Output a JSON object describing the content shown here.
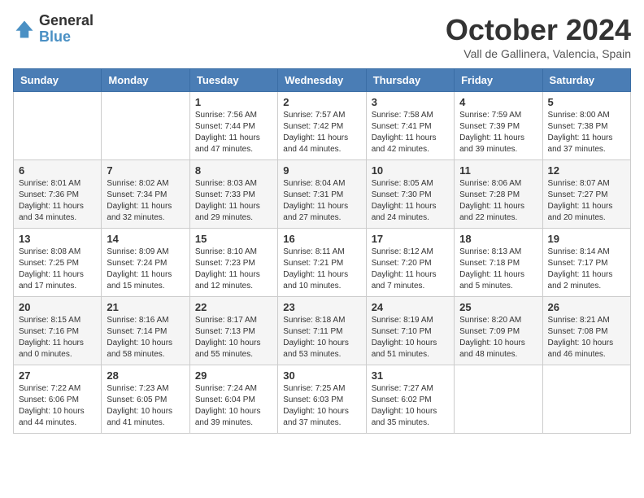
{
  "logo": {
    "general": "General",
    "blue": "Blue"
  },
  "header": {
    "month": "October 2024",
    "location": "Vall de Gallinera, Valencia, Spain"
  },
  "days_of_week": [
    "Sunday",
    "Monday",
    "Tuesday",
    "Wednesday",
    "Thursday",
    "Friday",
    "Saturday"
  ],
  "weeks": [
    [
      {
        "day": "",
        "info": ""
      },
      {
        "day": "",
        "info": ""
      },
      {
        "day": "1",
        "info": "Sunrise: 7:56 AM\nSunset: 7:44 PM\nDaylight: 11 hours and 47 minutes."
      },
      {
        "day": "2",
        "info": "Sunrise: 7:57 AM\nSunset: 7:42 PM\nDaylight: 11 hours and 44 minutes."
      },
      {
        "day": "3",
        "info": "Sunrise: 7:58 AM\nSunset: 7:41 PM\nDaylight: 11 hours and 42 minutes."
      },
      {
        "day": "4",
        "info": "Sunrise: 7:59 AM\nSunset: 7:39 PM\nDaylight: 11 hours and 39 minutes."
      },
      {
        "day": "5",
        "info": "Sunrise: 8:00 AM\nSunset: 7:38 PM\nDaylight: 11 hours and 37 minutes."
      }
    ],
    [
      {
        "day": "6",
        "info": "Sunrise: 8:01 AM\nSunset: 7:36 PM\nDaylight: 11 hours and 34 minutes."
      },
      {
        "day": "7",
        "info": "Sunrise: 8:02 AM\nSunset: 7:34 PM\nDaylight: 11 hours and 32 minutes."
      },
      {
        "day": "8",
        "info": "Sunrise: 8:03 AM\nSunset: 7:33 PM\nDaylight: 11 hours and 29 minutes."
      },
      {
        "day": "9",
        "info": "Sunrise: 8:04 AM\nSunset: 7:31 PM\nDaylight: 11 hours and 27 minutes."
      },
      {
        "day": "10",
        "info": "Sunrise: 8:05 AM\nSunset: 7:30 PM\nDaylight: 11 hours and 24 minutes."
      },
      {
        "day": "11",
        "info": "Sunrise: 8:06 AM\nSunset: 7:28 PM\nDaylight: 11 hours and 22 minutes."
      },
      {
        "day": "12",
        "info": "Sunrise: 8:07 AM\nSunset: 7:27 PM\nDaylight: 11 hours and 20 minutes."
      }
    ],
    [
      {
        "day": "13",
        "info": "Sunrise: 8:08 AM\nSunset: 7:25 PM\nDaylight: 11 hours and 17 minutes."
      },
      {
        "day": "14",
        "info": "Sunrise: 8:09 AM\nSunset: 7:24 PM\nDaylight: 11 hours and 15 minutes."
      },
      {
        "day": "15",
        "info": "Sunrise: 8:10 AM\nSunset: 7:23 PM\nDaylight: 11 hours and 12 minutes."
      },
      {
        "day": "16",
        "info": "Sunrise: 8:11 AM\nSunset: 7:21 PM\nDaylight: 11 hours and 10 minutes."
      },
      {
        "day": "17",
        "info": "Sunrise: 8:12 AM\nSunset: 7:20 PM\nDaylight: 11 hours and 7 minutes."
      },
      {
        "day": "18",
        "info": "Sunrise: 8:13 AM\nSunset: 7:18 PM\nDaylight: 11 hours and 5 minutes."
      },
      {
        "day": "19",
        "info": "Sunrise: 8:14 AM\nSunset: 7:17 PM\nDaylight: 11 hours and 2 minutes."
      }
    ],
    [
      {
        "day": "20",
        "info": "Sunrise: 8:15 AM\nSunset: 7:16 PM\nDaylight: 11 hours and 0 minutes."
      },
      {
        "day": "21",
        "info": "Sunrise: 8:16 AM\nSunset: 7:14 PM\nDaylight: 10 hours and 58 minutes."
      },
      {
        "day": "22",
        "info": "Sunrise: 8:17 AM\nSunset: 7:13 PM\nDaylight: 10 hours and 55 minutes."
      },
      {
        "day": "23",
        "info": "Sunrise: 8:18 AM\nSunset: 7:11 PM\nDaylight: 10 hours and 53 minutes."
      },
      {
        "day": "24",
        "info": "Sunrise: 8:19 AM\nSunset: 7:10 PM\nDaylight: 10 hours and 51 minutes."
      },
      {
        "day": "25",
        "info": "Sunrise: 8:20 AM\nSunset: 7:09 PM\nDaylight: 10 hours and 48 minutes."
      },
      {
        "day": "26",
        "info": "Sunrise: 8:21 AM\nSunset: 7:08 PM\nDaylight: 10 hours and 46 minutes."
      }
    ],
    [
      {
        "day": "27",
        "info": "Sunrise: 7:22 AM\nSunset: 6:06 PM\nDaylight: 10 hours and 44 minutes."
      },
      {
        "day": "28",
        "info": "Sunrise: 7:23 AM\nSunset: 6:05 PM\nDaylight: 10 hours and 41 minutes."
      },
      {
        "day": "29",
        "info": "Sunrise: 7:24 AM\nSunset: 6:04 PM\nDaylight: 10 hours and 39 minutes."
      },
      {
        "day": "30",
        "info": "Sunrise: 7:25 AM\nSunset: 6:03 PM\nDaylight: 10 hours and 37 minutes."
      },
      {
        "day": "31",
        "info": "Sunrise: 7:27 AM\nSunset: 6:02 PM\nDaylight: 10 hours and 35 minutes."
      },
      {
        "day": "",
        "info": ""
      },
      {
        "day": "",
        "info": ""
      }
    ]
  ]
}
